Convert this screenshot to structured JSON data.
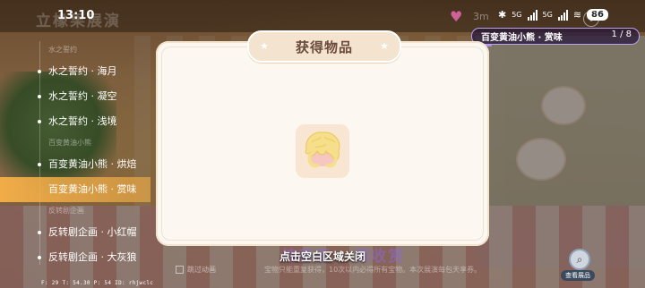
{
  "status_bar": {
    "time": "13:10",
    "background_title": "立橡果展演",
    "battery": "86",
    "network_label": "5G",
    "network_label_2": "5G",
    "bg_number": "3m"
  },
  "progress": {
    "label": "百变黄油小熊 · 赏味",
    "count": "1 / 8",
    "fraction": 0.125,
    "accent": "#b38cf0"
  },
  "sidebar": {
    "sections": [
      {
        "heading": "水之誓约",
        "items": [
          {
            "label": "水之誓约 · 海月",
            "active": false
          },
          {
            "label": "水之誓约 · 凝空",
            "active": false
          },
          {
            "label": "水之誓约 · 浅境",
            "active": false
          }
        ]
      },
      {
        "heading": "百变黄油小熊",
        "items": [
          {
            "label": "百变黄油小熊 · 烘焙",
            "active": false
          },
          {
            "label": "百变黄油小熊 · 赏味",
            "active": true
          }
        ]
      },
      {
        "heading": "反转剧企画",
        "items": [
          {
            "label": "反转剧企画 · 小红帽",
            "active": false
          },
          {
            "label": "反转剧企画 · 大灰狼",
            "active": false
          }
        ]
      }
    ]
  },
  "dialog": {
    "title": "获得物品",
    "item_icon": "fluffy-blonde-wig-icon"
  },
  "footer": {
    "tap_hint": "点击空白区域关闭",
    "background_banner": "纯奇乐 · 满收赏",
    "skip_label": "跳过动画",
    "subtext": "宝物只能重复获得，10次以内必得所有宝物。本次展演每包天享券。"
  },
  "map_button": {
    "label": "查看展品"
  },
  "debug": "F: 29    T: 54.30    P: 54    ID: rhjwclc",
  "colors": {
    "active_item": "#f6b048",
    "dialog_bg": "#fcf8f1",
    "title_tab": "#f4e4cf"
  }
}
